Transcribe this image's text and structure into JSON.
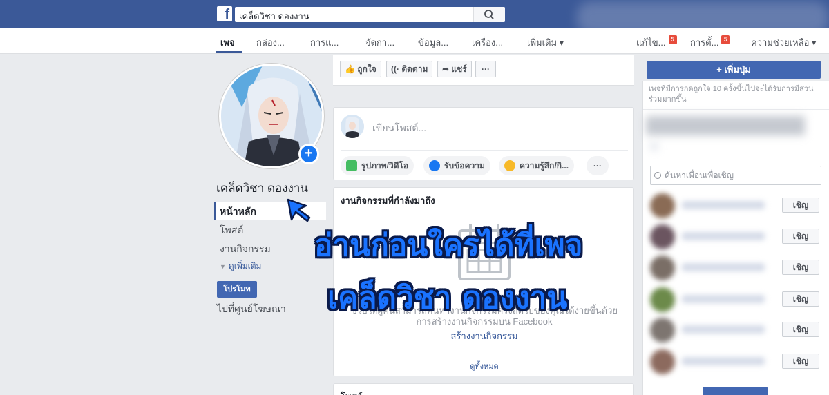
{
  "topbar": {
    "logo": "f",
    "search_value": "เคล็ดวิชา ดองงาน"
  },
  "pagenav": {
    "items": [
      "เพจ",
      "กล่อง...",
      "การแ...",
      "จัดกา...",
      "ข้อมูล...",
      "เครื่อง...",
      "เพิ่มเติม ▾"
    ],
    "right_items": [
      "แก้ไข...",
      "การตั้...",
      "ความช่วยเหลือ ▾"
    ],
    "badge": "5"
  },
  "left": {
    "page_name": "เคล็ดวิชา ดองงาน",
    "nav": [
      "หน้าหลัก",
      "โพสต์",
      "งานกิจกรรม"
    ],
    "see_more": "ดูเพิ่มเติม",
    "promote": "โปรโมท",
    "ad_center": "ไปที่ศูนย์โฆษณา"
  },
  "actionbar": {
    "like": "ถูกใจ",
    "follow": "ติดตาม",
    "share": "แชร์",
    "more": "···"
  },
  "composer": {
    "placeholder": "เขียนโพสต์...",
    "photo": "รูปภาพ/วิดีโอ",
    "message": "รับข้อความ",
    "feeling": "ความรู้สึก/กิ...",
    "more": "···"
  },
  "events": {
    "title": "งานกิจกรรมที่กำลังมาถึง",
    "desc_partial": "กรร",
    "desc_line1": "ช่วยให้ผู้คนสามารถค้นหางานกิจกรรมครั้งถัดไปของคุณได้ง่ายขึ้นด้วย",
    "desc_line2": "การสร้างงานกิจกรรมบน Facebook",
    "create": "สร้างงานกิจกรรม",
    "see_all": "ดูทั้งหมด"
  },
  "posts": {
    "title": "โพสต์"
  },
  "right": {
    "add_button": "+ เพิ่มปุ่ม",
    "hint": "เพจที่มีการกดถูกใจ 10 ครั้งขึ้นไปจะได้รับการมีส่วนร่วมมากขึ้น",
    "invite_placeholder": "ค้นหาเพื่อนเพื่อเชิญ",
    "invite_label": "เชิญ",
    "friend_colors": [
      "#8a6b55",
      "#6b5560",
      "#7a6e66",
      "#6c8a4a",
      "#7d7570",
      "#8c6a5e"
    ]
  },
  "overlay": {
    "line1": "อ่านก่อนใครได้ที่เพจ",
    "line2": "เคล็ดวิชา ดองงาน"
  },
  "colors": {
    "fb_blue": "#3b5998",
    "button_blue": "#4267b2",
    "overlay_blue": "#1a73ff"
  }
}
